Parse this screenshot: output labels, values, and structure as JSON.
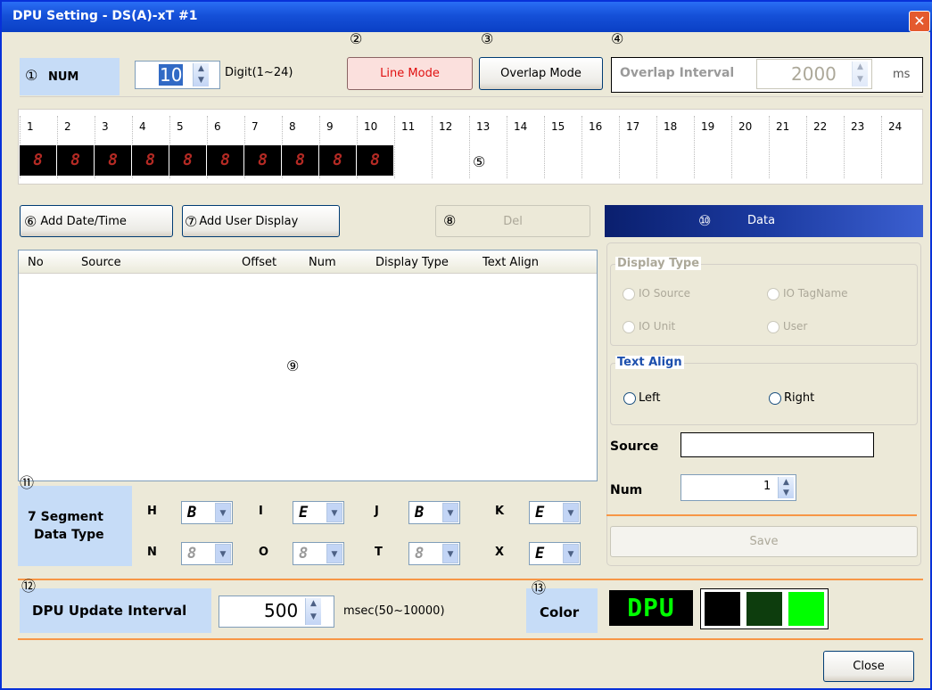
{
  "window": {
    "title": "DPU Setting - DS(A)-xT #1"
  },
  "markers": {
    "m1": "①",
    "m2": "②",
    "m3": "③",
    "m4": "④",
    "m5": "⑤",
    "m6": "⑥",
    "m7": "⑦",
    "m8": "⑧",
    "m9": "⑨",
    "m10": "⑩",
    "m11": "⑪",
    "m12": "⑫",
    "m13": "⑬"
  },
  "num": {
    "label": "NUM",
    "value": "10",
    "hint": "Digit(1~24)"
  },
  "modes": {
    "line": "Line Mode",
    "overlap": "Overlap Mode"
  },
  "overlap_interval": {
    "label": "Overlap Interval",
    "value": "2000",
    "unit": "ms"
  },
  "digits": {
    "headers": [
      "1",
      "2",
      "3",
      "4",
      "5",
      "6",
      "7",
      "8",
      "9",
      "10",
      "11",
      "12",
      "13",
      "14",
      "15",
      "16",
      "17",
      "18",
      "19",
      "20",
      "21",
      "22",
      "23",
      "24"
    ],
    "segment_glyph": "8",
    "active_count": 10
  },
  "actions": {
    "add_datetime": "Add Date/Time",
    "add_user": "Add User Display",
    "del": "Del"
  },
  "table": {
    "columns": [
      "No",
      "Source",
      "Offset",
      "Num",
      "Display Type",
      "Text Align"
    ],
    "rows": []
  },
  "data_panel": {
    "title": "Data",
    "display_type": {
      "label": "Display Type",
      "options": [
        "IO Source",
        "IO TagName",
        "IO Unit",
        "User"
      ]
    },
    "text_align": {
      "label": "Text Align",
      "options": [
        "Left",
        "Right"
      ]
    },
    "source_label": "Source",
    "source_value": "",
    "num_label": "Num",
    "num_value": "1",
    "save": "Save"
  },
  "segment_type": {
    "label_line1": "7 Segment",
    "label_line2": "Data Type",
    "items": [
      {
        "key": "H",
        "glyph": "B"
      },
      {
        "key": "I",
        "glyph": "E"
      },
      {
        "key": "J",
        "glyph": "B"
      },
      {
        "key": "K",
        "glyph": "E"
      },
      {
        "key": "N",
        "glyph": "8"
      },
      {
        "key": "O",
        "glyph": "8"
      },
      {
        "key": "T",
        "glyph": "8"
      },
      {
        "key": "X",
        "glyph": "E"
      }
    ]
  },
  "update": {
    "label": "DPU Update Interval",
    "value": "500",
    "hint": "msec(50~10000)"
  },
  "color": {
    "label": "Color",
    "preview": "DPU",
    "swatches": [
      "#000000",
      "#0d3d0d",
      "#00ff00"
    ]
  },
  "footer": {
    "close": "Close"
  }
}
